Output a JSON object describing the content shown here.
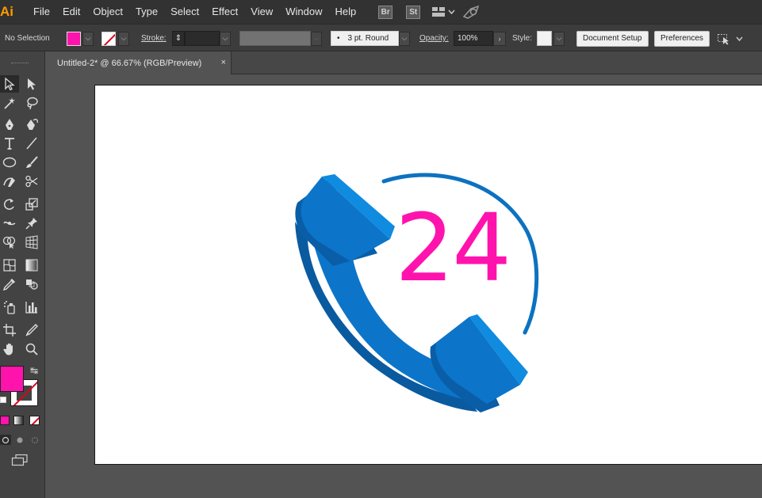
{
  "app": {
    "logo_text": "Ai",
    "menu": [
      "File",
      "Edit",
      "Object",
      "Type",
      "Select",
      "Effect",
      "View",
      "Window",
      "Help"
    ],
    "bridge_badge": "Br",
    "stock_badge": "St"
  },
  "control_bar": {
    "selection_label": "No Selection",
    "fill_color": "#ff13ad",
    "stroke_label": "Stroke:",
    "stroke_weight": "",
    "brush_label": "3 pt. Round",
    "opacity_label": "Opacity:",
    "opacity_value": "100%",
    "style_label": "Style:",
    "document_setup_label": "Document Setup",
    "preferences_label": "Preferences"
  },
  "document": {
    "tab_title": "Untitled-2* @ 66.67% (RGB/Preview)",
    "close_glyph": "×"
  },
  "artwork": {
    "number_text": "24",
    "number_color": "#ff13ad",
    "handset_color": "#0c75c9",
    "arc_color": "#0c72c0"
  },
  "toolbar": {
    "fill_swatch_color": "#ff13ad",
    "tools": [
      "selection-tool",
      "direct-selection-tool",
      "magic-wand-tool",
      "lasso-tool",
      "pen-tool",
      "curvature-tool",
      "type-tool",
      "line-segment-tool",
      "ellipse-tool",
      "paintbrush-tool",
      "shaper-tool",
      "scissors-tool",
      "rotate-tool",
      "scale-tool",
      "width-tool",
      "puppet-warp-tool",
      "shape-builder-tool",
      "perspective-grid-tool",
      "mesh-tool",
      "gradient-tool",
      "eyedropper-tool",
      "blend-tool",
      "symbol-sprayer-tool",
      "column-graph-tool",
      "artboard-tool",
      "slice-tool",
      "hand-tool",
      "zoom-tool"
    ]
  }
}
